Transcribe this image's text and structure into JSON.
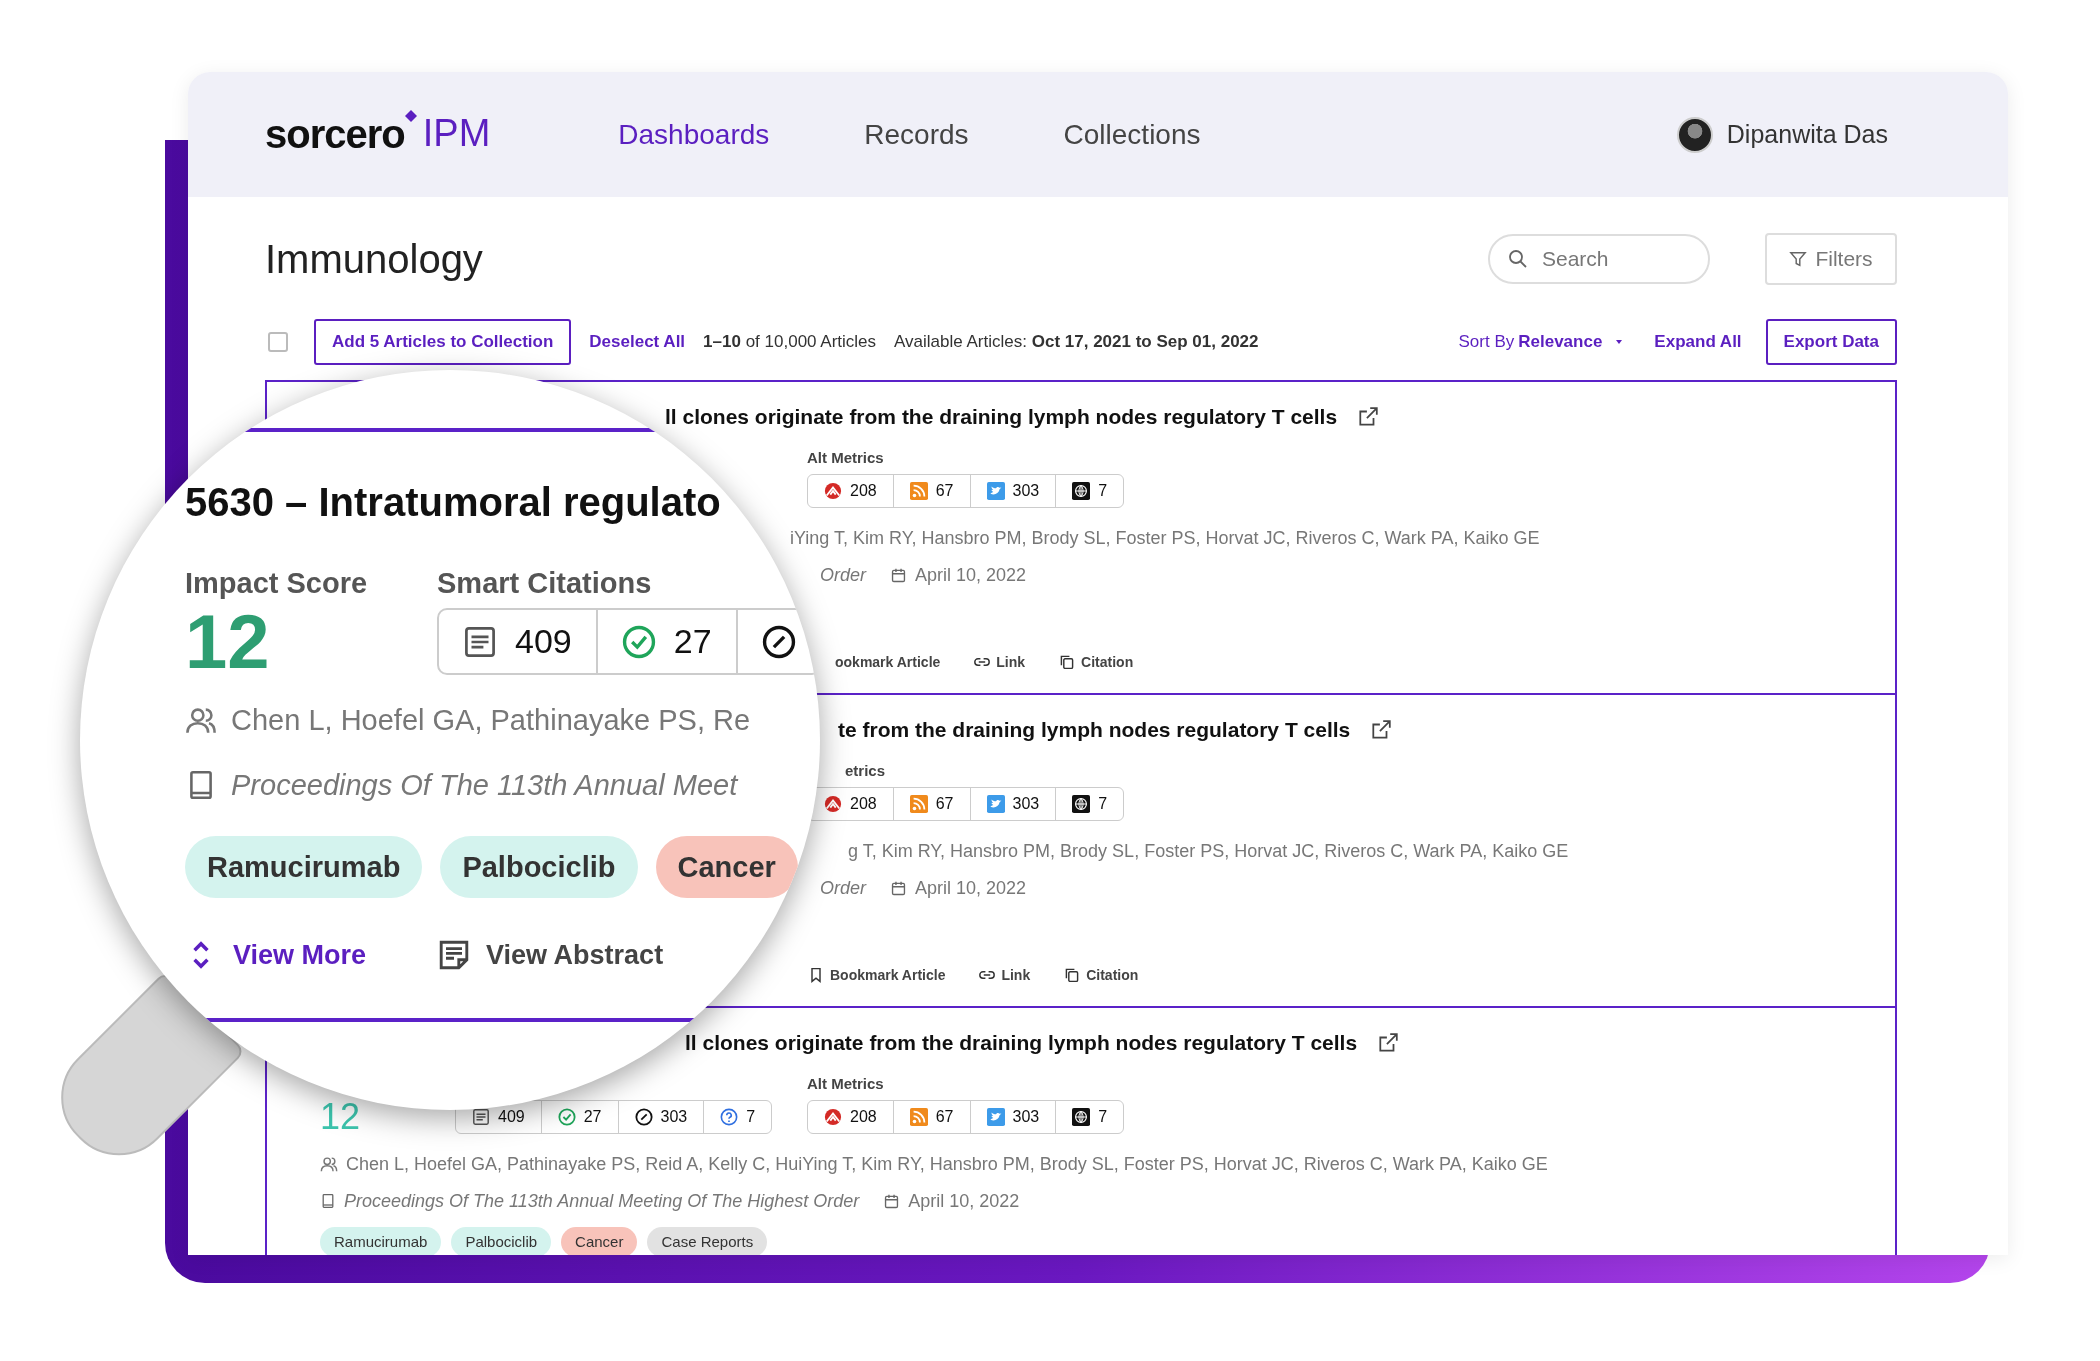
{
  "header": {
    "logo": {
      "wordmark": "sorcero",
      "product": "IPM"
    },
    "nav": [
      {
        "label": "Dashboards",
        "selected": true
      },
      {
        "label": "Records",
        "selected": false
      },
      {
        "label": "Collections",
        "selected": false
      }
    ],
    "user": {
      "name": "Dipanwita Das"
    }
  },
  "page": {
    "title": "Immunology",
    "search": {
      "placeholder": "Search"
    },
    "filters_button": "Filters"
  },
  "toolbar": {
    "select_all_checked": false,
    "add_button": "Add 5 Articles to Collection",
    "deselect": "Deselect All",
    "count": "**1–10** of 10,000 Articles",
    "available": "Available Articles: **Oct 17, 2021 to Sep 01, 2022**",
    "sort_label": "Sort By",
    "sort_value": "Relevance",
    "expand": "Expand All",
    "export": "Export Data"
  },
  "articles": [
    {
      "kind": "partial",
      "title": "ll clones originate from the draining lymph nodes regulatory T cells",
      "alt_metrics_label": "Alt Metrics",
      "alt_metrics": [
        {
          "kind": "altmetric",
          "value": "208"
        },
        {
          "kind": "rss",
          "value": "67"
        },
        {
          "kind": "twitter",
          "value": "303"
        },
        {
          "kind": "web",
          "value": "7"
        }
      ],
      "authors": "iYing T, Kim RY, Hansbro PM, Brody SL, Foster PS, Horvat JC, Riveros C, Wark PA, Kaiko GE",
      "journal": "Order",
      "date": "April 10, 2022",
      "actions": [
        {
          "kind": "fragment",
          "label": "ookmark Article"
        },
        {
          "kind": "link",
          "label": "Link"
        },
        {
          "kind": "citation",
          "label": "Citation"
        }
      ]
    },
    {
      "kind": "partial",
      "title": "te from the draining lymph nodes regulatory T cells",
      "alt_metrics_label": "etrics",
      "alt_metrics": [
        {
          "kind": "altmetric",
          "value": "208"
        },
        {
          "kind": "rss",
          "value": "67"
        },
        {
          "kind": "twitter",
          "value": "303"
        },
        {
          "kind": "web",
          "value": "7"
        }
      ],
      "authors": "g T, Kim RY, Hansbro PM, Brody SL, Foster PS, Horvat JC, Riveros C, Wark PA, Kaiko GE",
      "journal": "Order",
      "date": "April 10, 2022",
      "actions": [
        {
          "kind": "bookmark",
          "label": "Bookmark Article"
        },
        {
          "kind": "link",
          "label": "Link"
        },
        {
          "kind": "citation",
          "label": "Citation"
        }
      ]
    },
    {
      "kind": "full",
      "title": "ll clones originate from the draining lymph nodes regulatory T cells",
      "impact_score": "12",
      "smart_citations": [
        {
          "kind": "publications",
          "value": "409"
        },
        {
          "kind": "supporting",
          "value": "27"
        },
        {
          "kind": "contrasting",
          "value": "303"
        },
        {
          "kind": "mentioning",
          "value": "7"
        }
      ],
      "alt_metrics_label": "Alt Metrics",
      "alt_metrics": [
        {
          "kind": "altmetric",
          "value": "208"
        },
        {
          "kind": "rss",
          "value": "67"
        },
        {
          "kind": "twitter",
          "value": "303"
        },
        {
          "kind": "web",
          "value": "7"
        }
      ],
      "authors": "Chen L, Hoefel GA, Pathinayake PS, Reid A, Kelly C, HuiYing T, Kim RY, Hansbro PM, Brody SL, Foster PS, Horvat JC, Riveros C, Wark PA, Kaiko GE",
      "journal": "Proceedings Of The 113th Annual Meeting Of The Highest Order",
      "date": "April 10, 2022",
      "tags": [
        {
          "label": "Ramucirumab",
          "color": "#d4f3ee"
        },
        {
          "label": "Palbociclib",
          "color": "#d4f3ee"
        },
        {
          "label": "Cancer",
          "color": "#f8c3ba"
        },
        {
          "label": "Case Reports",
          "color": "#e2e2e2"
        }
      ]
    }
  ],
  "magnifier": {
    "title": "5630 – Intratumoral regulato",
    "impact_label": "Impact Score",
    "impact_score": "12",
    "citations_label": "Smart Citations",
    "smart_citations": [
      {
        "kind": "publications",
        "value": "409"
      },
      {
        "kind": "supporting",
        "value": "27"
      },
      {
        "kind": "contrasting"
      }
    ],
    "authors": "Chen L, Hoefel GA, Pathinayake PS, Re",
    "journal": "Proceedings Of The 113th Annual Meet",
    "tags": [
      {
        "label": "Ramucirumab",
        "color": "#d4f3ee"
      },
      {
        "label": "Palbociclib",
        "color": "#d4f3ee"
      },
      {
        "label": "Cancer",
        "color": "#f8c3ba"
      }
    ],
    "actions": [
      {
        "kind": "view_more",
        "label": "View More"
      },
      {
        "kind": "abstract",
        "label": "View Abstract"
      }
    ]
  }
}
